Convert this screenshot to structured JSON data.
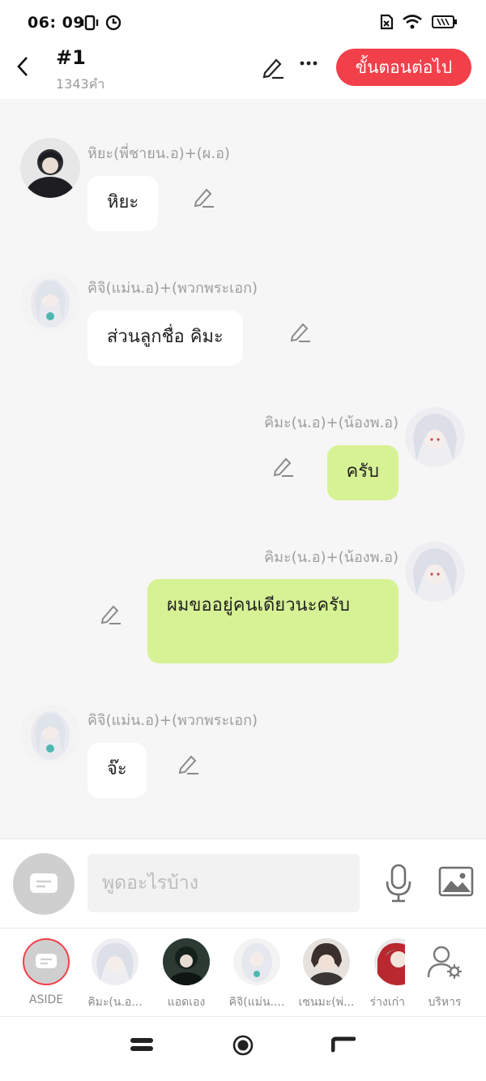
{
  "status_bar": {
    "time": "06: 09"
  },
  "header": {
    "title": "#1",
    "word_count": "1343คำ",
    "next_button": "ขั้นตอนต่อไป"
  },
  "messages": [
    {
      "speaker": "หิยะ(พี่ชายน.อ)+(ผ.อ)",
      "text": "หิยะ",
      "side": "left"
    },
    {
      "speaker": "คิจิ(แม่น.อ)+(พวกพระเอก)",
      "text": "ส่วนลูกชื่อ คิมะ",
      "side": "left"
    },
    {
      "speaker": "คิมะ(น.อ)+(น้องพ.อ)",
      "text": "ครับ",
      "side": "right"
    },
    {
      "speaker": "คิมะ(น.อ)+(น้องพ.อ)",
      "text": "ผมขออยู่คนเดียวนะครับ",
      "side": "right"
    },
    {
      "speaker": "คิจิ(แม่น.อ)+(พวกพระเอก)",
      "text": "จ๊ะ",
      "side": "left"
    }
  ],
  "input": {
    "placeholder": "พูดอะไรบ้าง"
  },
  "characters": [
    {
      "name": "ASIDE"
    },
    {
      "name": "คิมะ(น.อ..."
    },
    {
      "name": "แอดเอง"
    },
    {
      "name": "คิจิ(แม่น...."
    },
    {
      "name": "เซนมะ(พ่..."
    },
    {
      "name": "ร่างเก่า"
    },
    {
      "name": "บริหาร"
    }
  ],
  "colors": {
    "accent": "#f2404a",
    "right_bubble": "#d7f295",
    "left_bubble": "#ffffff",
    "background": "#f6f6f6"
  }
}
